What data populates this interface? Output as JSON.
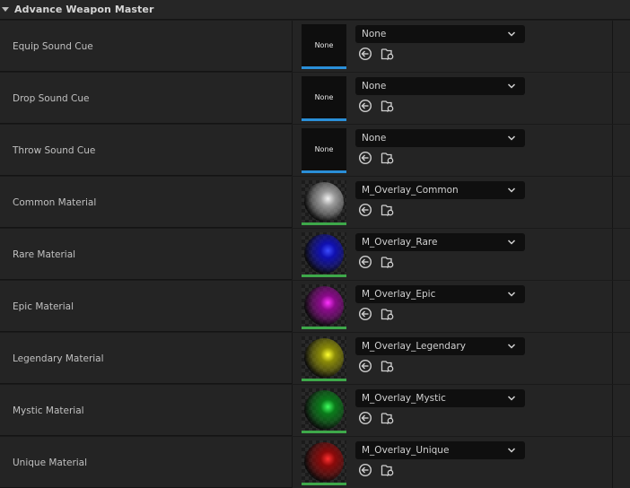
{
  "section": {
    "title": "Advance Weapon Master"
  },
  "rows": [
    {
      "label": "Equip Sound Cue",
      "kind": "sound",
      "thumb_text": "None",
      "value": "None",
      "bar_color": "#2a8fd8"
    },
    {
      "label": "Drop Sound Cue",
      "kind": "sound",
      "thumb_text": "None",
      "value": "None",
      "bar_color": "#2a8fd8"
    },
    {
      "label": "Throw Sound Cue",
      "kind": "sound",
      "thumb_text": "None",
      "value": "None",
      "bar_color": "#2a8fd8"
    },
    {
      "label": "Common Material",
      "kind": "material",
      "value": "M_Overlay_Common",
      "sphere_color": "#9a9a9a",
      "sphere_highlight": "#f2f2f2",
      "bar_color": "#3ea84a"
    },
    {
      "label": "Rare Material",
      "kind": "material",
      "value": "M_Overlay_Rare",
      "sphere_color": "#1010b0",
      "sphere_highlight": "#3c4cff",
      "bar_color": "#3ea84a"
    },
    {
      "label": "Epic Material",
      "kind": "material",
      "value": "M_Overlay_Epic",
      "sphere_color": "#8a0a8a",
      "sphere_highlight": "#ff33ff",
      "bar_color": "#3ea84a"
    },
    {
      "label": "Legendary Material",
      "kind": "material",
      "value": "M_Overlay_Legendary",
      "sphere_color": "#8a8a08",
      "sphere_highlight": "#ffff30",
      "bar_color": "#3ea84a"
    },
    {
      "label": "Mystic Material",
      "kind": "material",
      "value": "M_Overlay_Mystic",
      "sphere_color": "#0a7a1a",
      "sphere_highlight": "#40ff60",
      "bar_color": "#3ea84a"
    },
    {
      "label": "Unique Material",
      "kind": "material",
      "value": "M_Overlay_Unique",
      "sphere_color": "#8a0a0a",
      "sphere_highlight": "#ff3030",
      "bar_color": "#3ea84a"
    }
  ],
  "icons": {
    "use": "use-selected-asset-icon",
    "browse": "browse-to-asset-icon",
    "dropdown": "chevron-down-icon"
  }
}
